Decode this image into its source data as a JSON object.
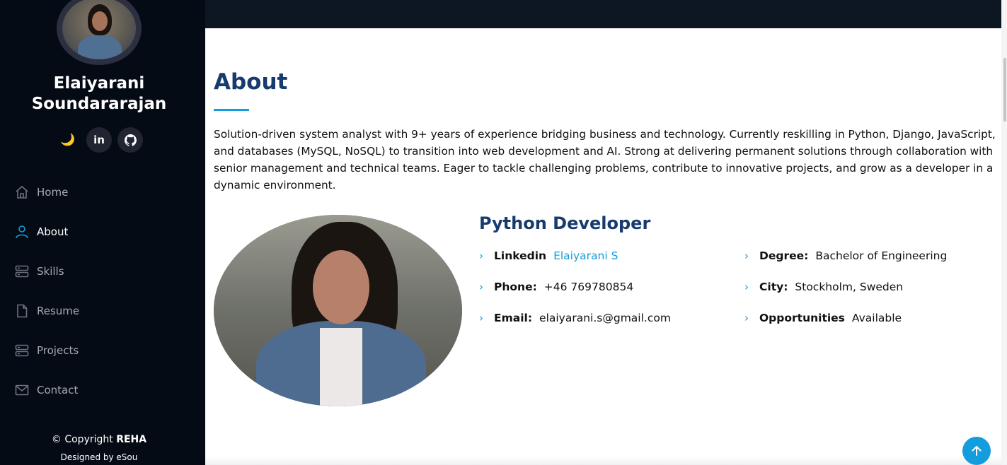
{
  "profile": {
    "name": "Elaiyarani Soundararajan"
  },
  "socials": [
    {
      "name": "moon-icon",
      "glyph": "🌙"
    },
    {
      "name": "linkedin-icon",
      "glyph": "in"
    },
    {
      "name": "github-icon",
      "glyph": "⌥"
    }
  ],
  "nav": {
    "items": [
      {
        "label": "Home",
        "icon": "home-icon"
      },
      {
        "label": "About",
        "icon": "person-icon",
        "active": true
      },
      {
        "label": "Skills",
        "icon": "server-icon"
      },
      {
        "label": "Resume",
        "icon": "file-icon"
      },
      {
        "label": "Projects",
        "icon": "server-icon"
      },
      {
        "label": "Contact",
        "icon": "envelope-icon"
      }
    ]
  },
  "footer": {
    "copyright_prefix": "© Copyright",
    "copyright_brand": "REHA",
    "designed_by": "Designed by eSou"
  },
  "about": {
    "title": "About",
    "text": "Solution-driven system analyst with 9+ years of experience bridging business and technology. Currently reskilling in Python, Django, JavaScript, and databases (MySQL, NoSQL) to transition into web development and AI. Strong at delivering permanent solutions through collaboration with senior management and technical teams. Eager to tackle challenging problems, contribute to innovative projects, and grow as a developer in a dynamic environment.",
    "role": "Python Developer",
    "left_info": [
      {
        "key": "Linkedin",
        "value": "Elaiyarani S",
        "link": true
      },
      {
        "key": "Phone:",
        "value": "+46 769780854"
      },
      {
        "key": "Email:",
        "value": "elaiyarani.s@gmail.com"
      }
    ],
    "right_info": [
      {
        "key": "Degree:",
        "value": "Bachelor of Engineering"
      },
      {
        "key": "City:",
        "value": "Stockholm, Sweden"
      },
      {
        "key": "Opportunities",
        "value": "Available"
      }
    ]
  },
  "colors": {
    "accent": "#149ddd",
    "sidebar_bg": "#040b14",
    "heading": "#173b6c"
  }
}
